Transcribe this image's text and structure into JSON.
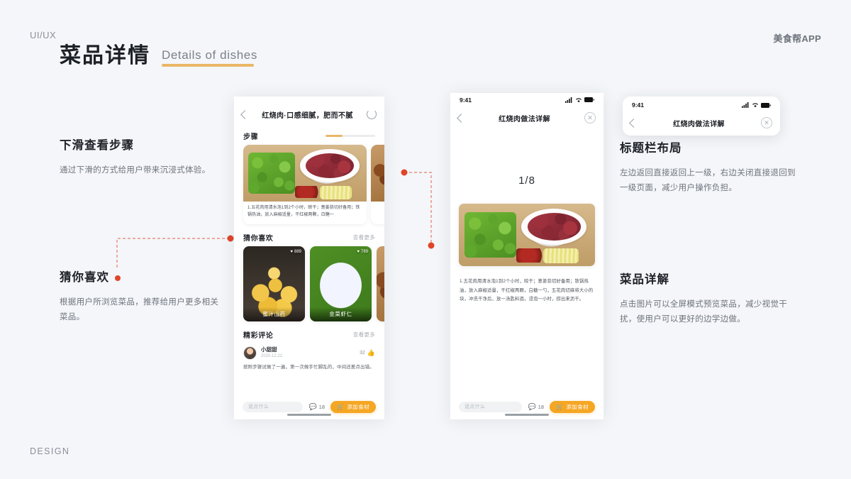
{
  "slide": {
    "kicker": "UI/UX",
    "brand": "美食帮APP",
    "title_cn": "菜品详情",
    "title_en": "Details of dishes",
    "footer": "DESIGN",
    "accent_color": "#eab767",
    "dot_color": "#e0452a",
    "background": "#f4f6f9"
  },
  "annotations": [
    {
      "id": "scroll",
      "heading": "下滑查看步骤",
      "body": "通过下滑的方式给用户带来沉浸式体验。"
    },
    {
      "id": "guess",
      "heading": "猜你喜欢",
      "body": "根据用户所浏览菜品，推荐给用户更多相关菜品。"
    },
    {
      "id": "titlebar",
      "heading": "标题栏布局",
      "body": "左边返回直接返回上一级，右边关闭直接退回到一级页面，减少用户操作负担。"
    },
    {
      "id": "detail",
      "heading": "菜品详解",
      "body": "点击图片可以全屏模式预览菜品，减少视觉干扰，使用户可以更好的边学边做。"
    }
  ],
  "phone1": {
    "nav": {
      "back_icon": "chevron-left-icon",
      "title": "红烧肉·口感细腻，肥而不腻",
      "refresh_icon": "refresh-icon"
    },
    "steps_section": {
      "title": "步骤",
      "progress_percent": 34,
      "cards": [
        {
          "caption": "1.五花肉用清水泡1到2个小时，晾干；葱姜蒜切好备用；铁锅热油，放入麻椒适量，干红椒两颗，白糖一"
        }
      ]
    },
    "guess_section": {
      "title": "猜你喜欢",
      "more": "查看更多",
      "dishes": [
        {
          "name": "蜜汁山药",
          "likes": "889"
        },
        {
          "name": "韭菜虾仁",
          "likes": "789"
        }
      ]
    },
    "comments_section": {
      "title": "精彩评论",
      "more": "查看更多",
      "comment": {
        "author": "小甜甜",
        "date": "2020.12.22",
        "likes": "32",
        "like_icon": "thumbs-up-icon",
        "text": "按照步骤试做了一遍，第一次做手忙脚乱的，中间还差点出错。"
      }
    },
    "bottom_bar": {
      "input_placeholder": "说点什么",
      "comment_icon": "comment-bubble-icon",
      "comment_count": "18",
      "add_icon": "cart-icon",
      "add_label": "添加食材"
    }
  },
  "phone2": {
    "status": {
      "time": "9:41",
      "signal_icon": "cellular-signal-icon",
      "wifi_icon": "wifi-icon",
      "battery_icon": "battery-icon"
    },
    "nav": {
      "back_icon": "chevron-left-icon",
      "title": "红烧肉做法详解",
      "close_icon": "close-circle-icon"
    },
    "pager": "1/8",
    "recipe_text": "1.五花肉用清水泡1到2个小时，晾干；葱姜蒜切好备用；铁锅热油，放入麻椒适量，干红椒两颗，白糖一勺，五花肉切麻将大小的块，冲洗干净后，放一汤匙料酒，浸泡一小时，捞出来沥干。",
    "bottom_bar": {
      "input_placeholder": "说点什么",
      "comment_icon": "comment-bubble-icon",
      "comment_count": "18",
      "add_icon": "cart-icon",
      "add_label": "添加食材"
    }
  },
  "phone3": {
    "status": {
      "time": "9:41",
      "signal_icon": "cellular-signal-icon",
      "wifi_icon": "wifi-icon",
      "battery_icon": "battery-icon"
    },
    "nav": {
      "back_icon": "chevron-left-icon",
      "title": "红烧肉做法详解",
      "close_icon": "close-circle-icon"
    }
  }
}
